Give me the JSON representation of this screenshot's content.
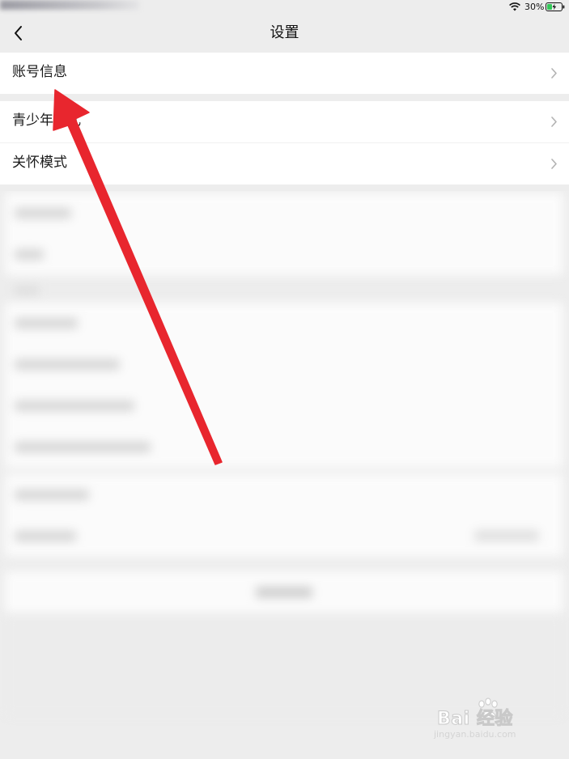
{
  "status_bar": {
    "battery_percent": "30%",
    "icons": [
      "wifi-icon",
      "battery-charging-icon"
    ]
  },
  "nav": {
    "title": "设置",
    "back_icon": "chevron-left-icon"
  },
  "groups": [
    {
      "items": [
        {
          "label": "账号信息",
          "icon": "chevron-right-icon"
        }
      ]
    },
    {
      "items": [
        {
          "label": "青少年模式",
          "icon": "chevron-right-icon"
        },
        {
          "label": "关怀模式",
          "icon": "chevron-right-icon"
        }
      ]
    }
  ],
  "annotation": {
    "color": "#e8262e"
  },
  "watermark": {
    "brand": "Bai 经验",
    "url": "jingyan.baidu.com"
  },
  "colors": {
    "page_background": "#ededed",
    "card_background": "#ffffff",
    "text": "#1a1a1a",
    "chevron": "#b2b2b2"
  }
}
